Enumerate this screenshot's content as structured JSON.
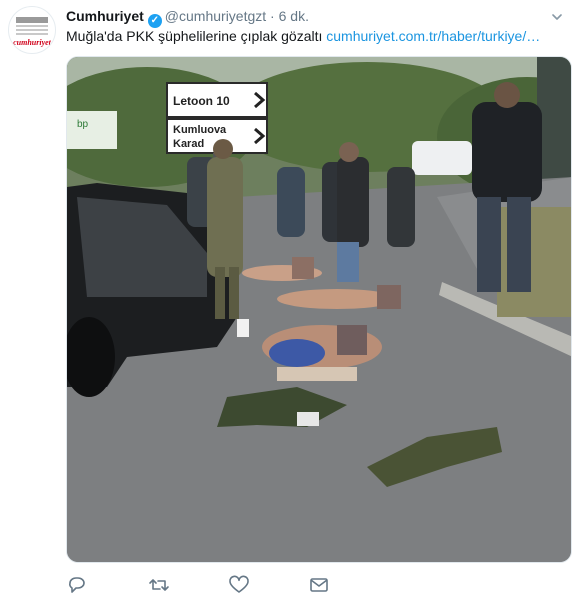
{
  "tweet": {
    "avatar_brand": "cumhuriyet",
    "name": "Cumhuriyet",
    "verified_mark": "✓",
    "handle": "@cumhuriyetgzt",
    "separator": "·",
    "time": "6 dk.",
    "text": "Muğla'da PKK şüphelilerine çıplak gözaltı",
    "link": "cumhuriyet.com.tr/haber/turkiye/…",
    "photo": {
      "sign_top": "Letoon 10",
      "sign_bottom_line1": "Kumluova",
      "sign_bottom_line2": "Karad",
      "sign_left": "bp"
    },
    "icons": {
      "more": "chevron-down-icon",
      "reply": "reply-icon",
      "retweet": "retweet-icon",
      "like": "heart-icon",
      "dm": "envelope-icon"
    }
  },
  "colors": {
    "link": "#1b95e0",
    "muted": "#657786",
    "verified": "#1da1f2",
    "brand": "#d0021b"
  }
}
